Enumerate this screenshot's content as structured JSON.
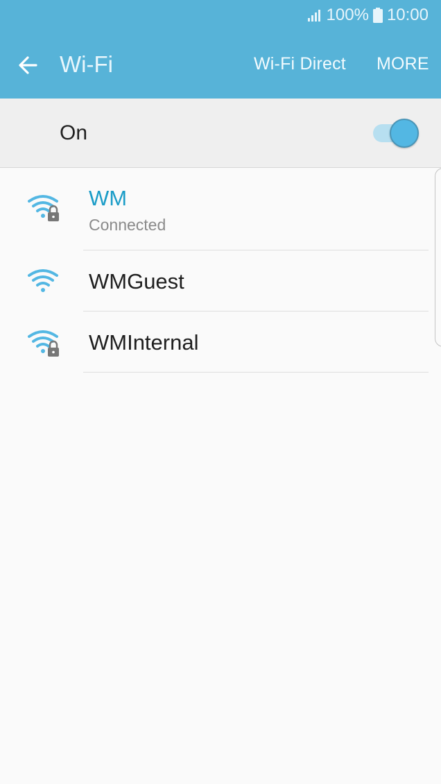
{
  "status_bar": {
    "battery": "100%",
    "time": "10:00",
    "icons": [
      "signal-icon",
      "battery-icon"
    ]
  },
  "toolbar": {
    "back_icon": "arrow-left-icon",
    "title": "Wi-Fi",
    "direct_label": "Wi-Fi Direct",
    "more_label": "MORE"
  },
  "master_switch": {
    "label": "On",
    "state": "on"
  },
  "networks": [
    {
      "name": "WM",
      "status": "Connected",
      "secured": true,
      "connected": true
    },
    {
      "name": "WMGuest",
      "status": "",
      "secured": false,
      "connected": false
    },
    {
      "name": "WMInternal",
      "status": "",
      "secured": true,
      "connected": false
    }
  ],
  "colors": {
    "appbar": "#57b3d8",
    "accent": "#1a9cc7",
    "switch_on": "#53b7e3",
    "wifi_icon": "#53b7e3",
    "lock_icon": "#777777"
  }
}
